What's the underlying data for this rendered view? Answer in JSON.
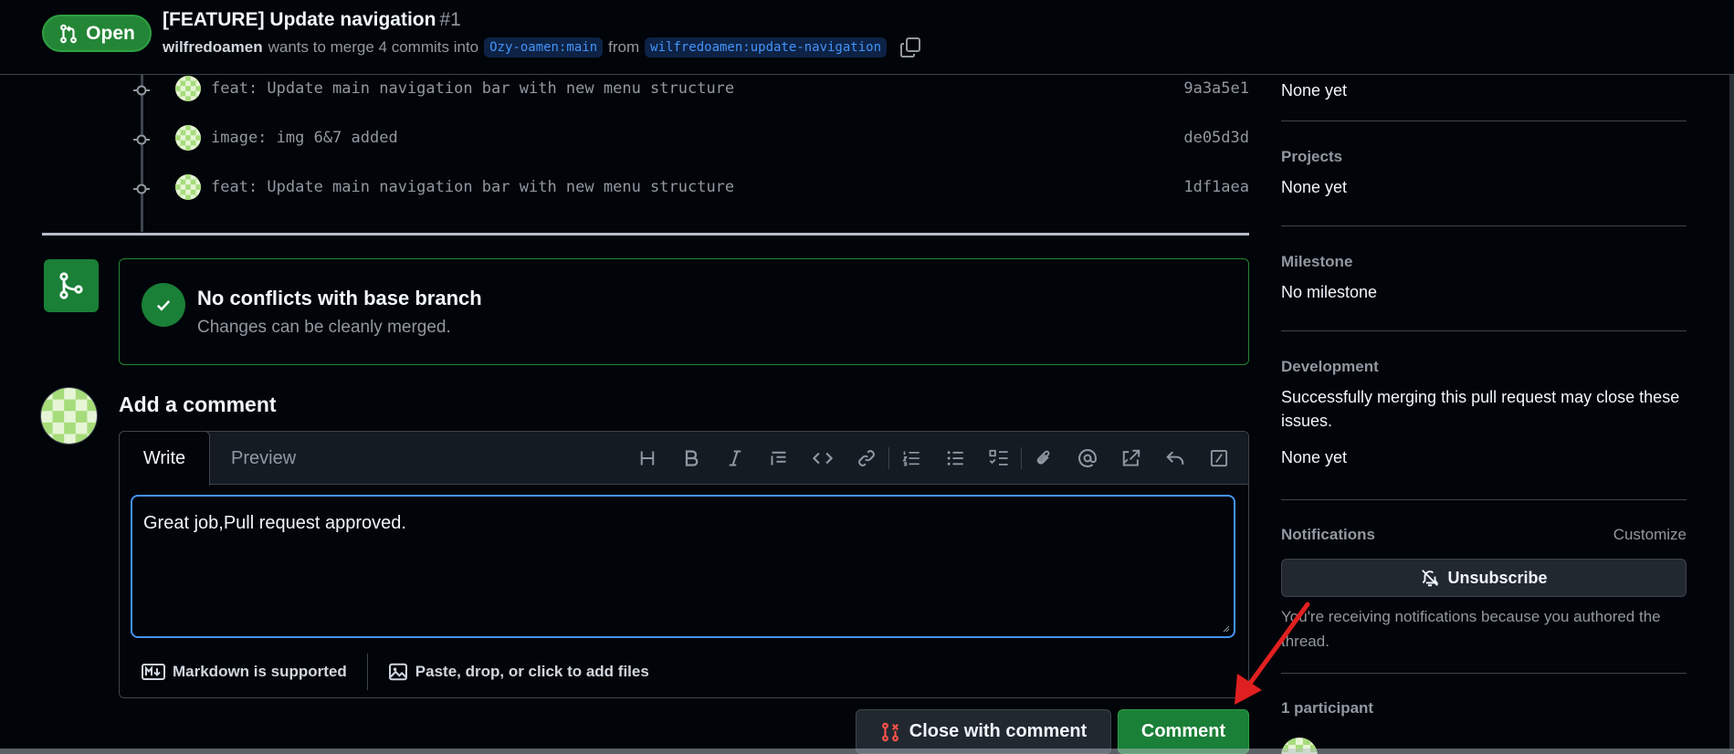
{
  "header": {
    "state": "Open",
    "title": "[FEATURE] Update navigation",
    "number": "#1",
    "author": "wilfredoamen",
    "merge_text": "wants to merge 4 commits into",
    "base_branch": "Ozy-oamen:main",
    "from_text": "from",
    "head_branch": "wilfredoamen:update-navigation"
  },
  "commits": [
    {
      "message": "feat: Update main navigation bar with new menu structure",
      "sha": "9a3a5e1"
    },
    {
      "message": "image: img 6&7 added",
      "sha": "de05d3d"
    },
    {
      "message": "feat: Update main navigation bar with new menu structure",
      "sha": "1df1aea"
    }
  ],
  "merge_status": {
    "title": "No conflicts with base branch",
    "description": "Changes can be cleanly merged."
  },
  "composer": {
    "heading": "Add a comment",
    "tab_write": "Write",
    "tab_preview": "Preview",
    "text": "Great job,Pull request approved.",
    "markdown_note": "Markdown is supported",
    "attach_note": "Paste, drop, or click to add files"
  },
  "actions": {
    "close_with_comment": "Close with comment",
    "comment": "Comment"
  },
  "sidebar": {
    "labels_value": "None yet",
    "projects_heading": "Projects",
    "projects_value": "None yet",
    "milestone_heading": "Milestone",
    "milestone_value": "No milestone",
    "development_heading": "Development",
    "development_text": "Successfully merging this pull request may close these issues.",
    "development_value": "None yet",
    "notifications_heading": "Notifications",
    "customize": "Customize",
    "unsubscribe": "Unsubscribe",
    "notifications_text": "You're receiving notifications because you authored the thread.",
    "participants_heading": "1 participant"
  },
  "colors": {
    "accent_green": "#238636",
    "focus_blue": "#4493f8",
    "annotation_red": "#e02020"
  }
}
